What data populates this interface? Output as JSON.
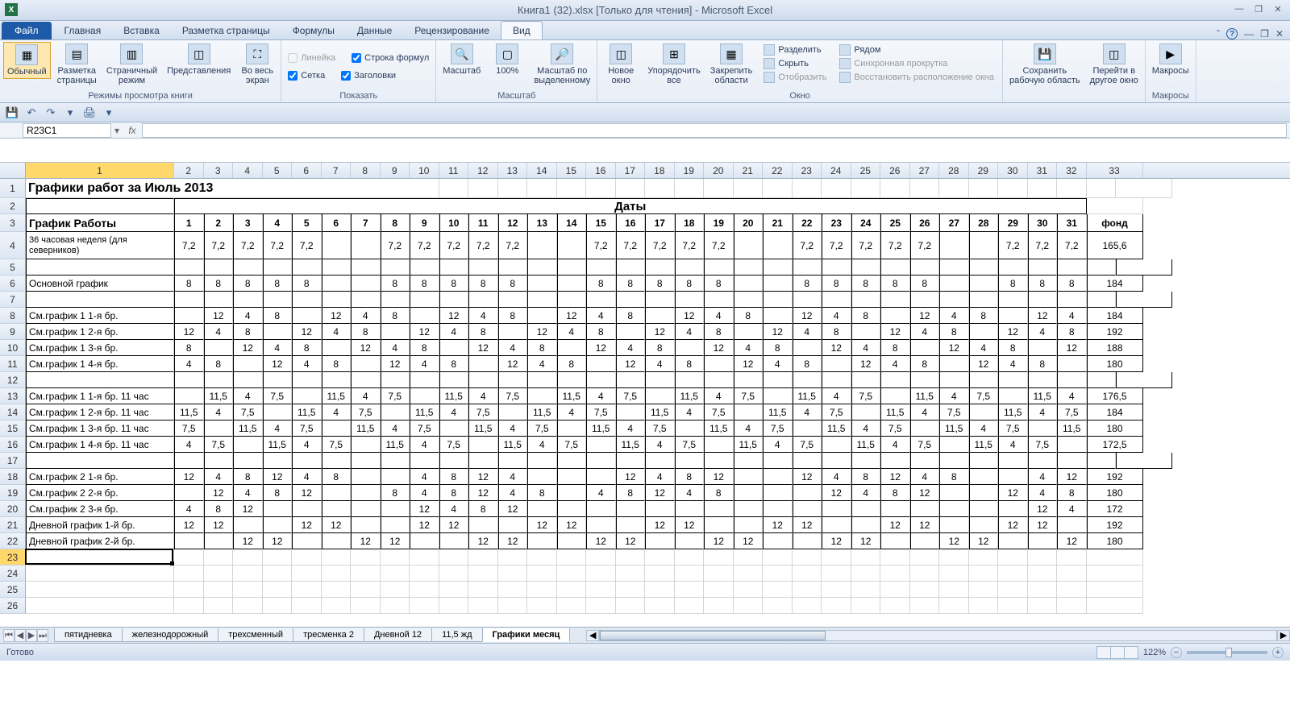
{
  "title": "Книга1 (32).xlsx  [Только для чтения] - Microsoft Excel",
  "tabs": {
    "file": "Файл",
    "home": "Главная",
    "insert": "Вставка",
    "layout": "Разметка страницы",
    "formulas": "Формулы",
    "data": "Данные",
    "review": "Рецензирование",
    "view": "Вид"
  },
  "ribbon": {
    "group1": {
      "normal": "Обычный",
      "page_layout": "Разметка\nстраницы",
      "page_break": "Страничный\nрежим",
      "custom": "Представления",
      "full": "Во весь\nэкран",
      "label": "Режимы просмотра книги"
    },
    "group2": {
      "ruler": "Линейка",
      "formula_bar": "Строка формул",
      "grid": "Сетка",
      "headings": "Заголовки",
      "label": "Показать"
    },
    "group3": {
      "zoom": "Масштаб",
      "z100": "100%",
      "zoom_sel": "Масштаб по\nвыделенному",
      "label": "Масштаб"
    },
    "group4": {
      "new_win": "Новое\nокно",
      "arrange": "Упорядочить\nвсе",
      "freeze": "Закрепить\nобласти",
      "split": "Разделить",
      "hide": "Скрыть",
      "unhide": "Отобразить",
      "side": "Рядом",
      "sync": "Синхронная прокрутка",
      "reset": "Восстановить расположение окна",
      "label": "Окно"
    },
    "group5": {
      "save_ws": "Сохранить\nрабочую область",
      "switch": "Перейти в\nдругое окно"
    },
    "group6": {
      "macros": "Макросы",
      "label": "Макросы"
    }
  },
  "name_box": "R23C1",
  "col_headers": [
    "1",
    "2",
    "3",
    "4",
    "5",
    "6",
    "7",
    "8",
    "9",
    "10",
    "11",
    "12",
    "13",
    "14",
    "15",
    "16",
    "17",
    "18",
    "19",
    "20",
    "21",
    "22",
    "23",
    "24",
    "25",
    "26",
    "27",
    "28",
    "29",
    "30",
    "31",
    "32",
    "33"
  ],
  "row_headers": [
    "1",
    "2",
    "3",
    "4",
    "5",
    "6",
    "7",
    "8",
    "9",
    "10",
    "11",
    "12",
    "13",
    "14",
    "15",
    "16",
    "17",
    "18",
    "19",
    "20",
    "21",
    "22",
    "23",
    "24",
    "25",
    "26"
  ],
  "titles": {
    "main": "Графики работ за Июль 2013",
    "dates": "Даты",
    "schedule": "График Работы",
    "fund": "фонд"
  },
  "day_nums": [
    "1",
    "2",
    "3",
    "4",
    "5",
    "6",
    "7",
    "8",
    "9",
    "10",
    "11",
    "12",
    "13",
    "14",
    "15",
    "16",
    "17",
    "18",
    "19",
    "20",
    "21",
    "22",
    "23",
    "24",
    "25",
    "26",
    "27",
    "28",
    "29",
    "30",
    "31"
  ],
  "rows": [
    {
      "label": "36 часовая неделя (для северников)",
      "d": [
        "7,2",
        "7,2",
        "7,2",
        "7,2",
        "7,2",
        "",
        "",
        "7,2",
        "7,2",
        "7,2",
        "7,2",
        "7,2",
        "",
        "",
        "7,2",
        "7,2",
        "7,2",
        "7,2",
        "7,2",
        "",
        "",
        "7,2",
        "7,2",
        "7,2",
        "7,2",
        "7,2",
        "",
        "",
        "7,2",
        "7,2",
        "7,2"
      ],
      "f": "165,6"
    },
    {
      "label": "",
      "d": [
        "",
        "",
        "",
        "",
        "",
        "",
        "",
        "",
        "",
        "",
        "",
        "",
        "",
        "",
        "",
        "",
        "",
        "",
        "",
        "",
        "",
        "",
        "",
        "",
        "",
        "",
        "",
        "",
        "",
        "",
        "",
        ""
      ],
      "f": ""
    },
    {
      "label": "Основной график",
      "d": [
        "8",
        "8",
        "8",
        "8",
        "8",
        "",
        "",
        "8",
        "8",
        "8",
        "8",
        "8",
        "",
        "",
        "8",
        "8",
        "8",
        "8",
        "8",
        "",
        "",
        "8",
        "8",
        "8",
        "8",
        "8",
        "",
        "",
        "8",
        "8",
        "8"
      ],
      "f": "184"
    },
    {
      "label": "",
      "d": [
        "",
        "",
        "",
        "",
        "",
        "",
        "",
        "",
        "",
        "",
        "",
        "",
        "",
        "",
        "",
        "",
        "",
        "",
        "",
        "",
        "",
        "",
        "",
        "",
        "",
        "",
        "",
        "",
        "",
        "",
        "",
        ""
      ],
      "f": ""
    },
    {
      "label": "См.график 1   1-я бр.",
      "d": [
        "",
        "12",
        "4",
        "8",
        "",
        "12",
        "4",
        "8",
        "",
        "12",
        "4",
        "8",
        "",
        "12",
        "4",
        "8",
        "",
        "12",
        "4",
        "8",
        "",
        "12",
        "4",
        "8",
        "",
        "12",
        "4",
        "8",
        "",
        "12",
        "4"
      ],
      "f": "184"
    },
    {
      "label": "См.график 1   2-я бр.",
      "d": [
        "12",
        "4",
        "8",
        "",
        "12",
        "4",
        "8",
        "",
        "12",
        "4",
        "8",
        "",
        "12",
        "4",
        "8",
        "",
        "12",
        "4",
        "8",
        "",
        "12",
        "4",
        "8",
        "",
        "12",
        "4",
        "8",
        "",
        "12",
        "4",
        "8"
      ],
      "f": "192"
    },
    {
      "label": "См.график 1   3-я бр.",
      "d": [
        "8",
        "",
        "12",
        "4",
        "8",
        "",
        "12",
        "4",
        "8",
        "",
        "12",
        "4",
        "8",
        "",
        "12",
        "4",
        "8",
        "",
        "12",
        "4",
        "8",
        "",
        "12",
        "4",
        "8",
        "",
        "12",
        "4",
        "8",
        "",
        "12"
      ],
      "f": "188"
    },
    {
      "label": "См.график 1   4-я бр.",
      "d": [
        "4",
        "8",
        "",
        "12",
        "4",
        "8",
        "",
        "12",
        "4",
        "8",
        "",
        "12",
        "4",
        "8",
        "",
        "12",
        "4",
        "8",
        "",
        "12",
        "4",
        "8",
        "",
        "12",
        "4",
        "8",
        "",
        "12",
        "4",
        "8",
        ""
      ],
      "f": "180"
    },
    {
      "label": "",
      "d": [
        "",
        "",
        "",
        "",
        "",
        "",
        "",
        "",
        "",
        "",
        "",
        "",
        "",
        "",
        "",
        "",
        "",
        "",
        "",
        "",
        "",
        "",
        "",
        "",
        "",
        "",
        "",
        "",
        "",
        "",
        "",
        ""
      ],
      "f": ""
    },
    {
      "label": "См.график 1   1-я бр. 11 час",
      "d": [
        "",
        "11,5",
        "4",
        "7,5",
        "",
        "11,5",
        "4",
        "7,5",
        "",
        "11,5",
        "4",
        "7,5",
        "",
        "11,5",
        "4",
        "7,5",
        "",
        "11,5",
        "4",
        "7,5",
        "",
        "11,5",
        "4",
        "7,5",
        "",
        "11,5",
        "4",
        "7,5",
        "",
        "11,5",
        "4"
      ],
      "f": "176,5"
    },
    {
      "label": "См.график 1   2-я бр. 11 час",
      "d": [
        "11,5",
        "4",
        "7,5",
        "",
        "11,5",
        "4",
        "7,5",
        "",
        "11,5",
        "4",
        "7,5",
        "",
        "11,5",
        "4",
        "7,5",
        "",
        "11,5",
        "4",
        "7,5",
        "",
        "11,5",
        "4",
        "7,5",
        "",
        "11,5",
        "4",
        "7,5",
        "",
        "11,5",
        "4",
        "7,5"
      ],
      "f": "184"
    },
    {
      "label": "См.график 1   3-я бр. 11 час",
      "d": [
        "7,5",
        "",
        "11,5",
        "4",
        "7,5",
        "",
        "11,5",
        "4",
        "7,5",
        "",
        "11,5",
        "4",
        "7,5",
        "",
        "11,5",
        "4",
        "7,5",
        "",
        "11,5",
        "4",
        "7,5",
        "",
        "11,5",
        "4",
        "7,5",
        "",
        "11,5",
        "4",
        "7,5",
        "",
        "11,5"
      ],
      "f": "180"
    },
    {
      "label": "См.график 1   4-я бр. 11 час",
      "d": [
        "4",
        "7,5",
        "",
        "11,5",
        "4",
        "7,5",
        "",
        "11,5",
        "4",
        "7,5",
        "",
        "11,5",
        "4",
        "7,5",
        "",
        "11,5",
        "4",
        "7,5",
        "",
        "11,5",
        "4",
        "7,5",
        "",
        "11,5",
        "4",
        "7,5",
        "",
        "11,5",
        "4",
        "7,5",
        ""
      ],
      "f": "172,5"
    },
    {
      "label": "",
      "d": [
        "",
        "",
        "",
        "",
        "",
        "",
        "",
        "",
        "",
        "",
        "",
        "",
        "",
        "",
        "",
        "",
        "",
        "",
        "",
        "",
        "",
        "",
        "",
        "",
        "",
        "",
        "",
        "",
        "",
        "",
        "",
        ""
      ],
      "f": ""
    },
    {
      "label": "См.график 2   1-я бр.",
      "d": [
        "12",
        "4",
        "8",
        "12",
        "4",
        "8",
        "",
        "",
        "4",
        "8",
        "12",
        "4",
        "",
        "",
        "",
        "12",
        "4",
        "8",
        "12",
        "",
        "",
        "12",
        "4",
        "8",
        "12",
        "4",
        "8",
        "",
        "",
        "4",
        "12"
      ],
      "f": "192"
    },
    {
      "label": "См.график 2   2-я бр.",
      "d": [
        "",
        "12",
        "4",
        "8",
        "12",
        "",
        "",
        "8",
        "4",
        "8",
        "12",
        "4",
        "8",
        "",
        "4",
        "8",
        "12",
        "4",
        "8",
        "",
        "",
        "",
        "12",
        "4",
        "8",
        "12",
        "",
        "",
        "12",
        "4",
        "8"
      ],
      "f": "180"
    },
    {
      "label": "См.график 2   3-я бр.",
      "d": [
        "4",
        "8",
        "12",
        "",
        "",
        "",
        "",
        "",
        "12",
        "4",
        "8",
        "12",
        "",
        "",
        "",
        "",
        "",
        "",
        "",
        "",
        "",
        "",
        "",
        "",
        "",
        "",
        "",
        "",
        "",
        "12",
        "4"
      ],
      "f": "172"
    },
    {
      "label": "Дневной график 1-й бр.",
      "d": [
        "12",
        "12",
        "",
        "",
        "12",
        "12",
        "",
        "",
        "12",
        "12",
        "",
        "",
        "12",
        "12",
        "",
        "",
        "12",
        "12",
        "",
        "",
        "12",
        "12",
        "",
        "",
        "12",
        "12",
        "",
        "",
        "12",
        "12",
        ""
      ],
      "f": "192"
    },
    {
      "label": "Дневной график 2-й бр.",
      "d": [
        "",
        "",
        "12",
        "12",
        "",
        "",
        "12",
        "12",
        "",
        "",
        "12",
        "12",
        "",
        "",
        "12",
        "12",
        "",
        "",
        "12",
        "12",
        "",
        "",
        "12",
        "12",
        "",
        "",
        "12",
        "12",
        "",
        "",
        "12"
      ],
      "f": "180"
    }
  ],
  "sheet_tabs": [
    "пятидневка",
    "железнодорожный",
    "трехсменный",
    "тресменка 2",
    "Дневной 12",
    "11,5 жд",
    "Графики месяц"
  ],
  "status": {
    "ready": "Готово",
    "zoom": "122%"
  },
  "col_widths": {
    "first": 184,
    "day": 36.5,
    "fund": 70
  }
}
